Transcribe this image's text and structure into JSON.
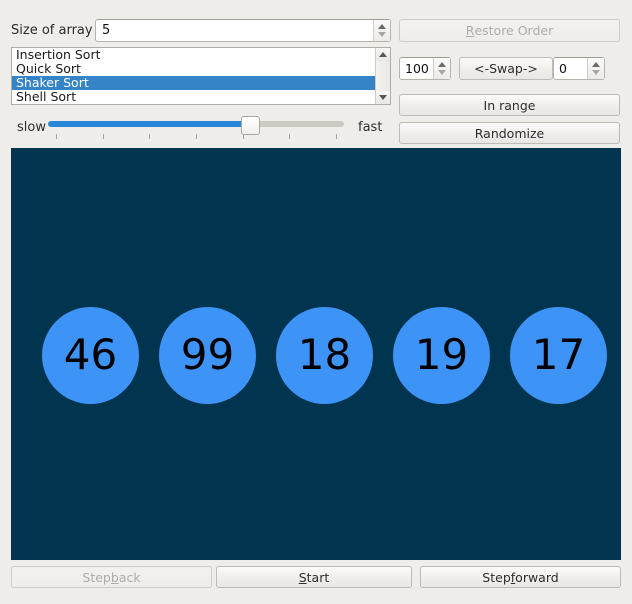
{
  "window": {
    "background": "#EFEDEA"
  },
  "controls": {
    "size_label": "Size of array",
    "size_value": "5",
    "restore_order_label": "Restore Order",
    "restore_order_mnemonic": "R",
    "restore_order_rest": "estore Order",
    "restore_order_enabled": false,
    "swap_left_value": "100",
    "swap_button_label": "<-Swap->",
    "swap_right_value": "0",
    "in_range_label": "In range",
    "randomize_label": "Randomize"
  },
  "algorithm_list": {
    "items": [
      {
        "label": "Insertion Sort",
        "selected": false
      },
      {
        "label": "Quick Sort",
        "selected": false
      },
      {
        "label": "Shaker Sort",
        "selected": true
      },
      {
        "label": "Shell Sort",
        "selected": false
      }
    ],
    "selected_label": "Shaker Sort",
    "selection_color": "#3584C8",
    "scroll_up_icon": "triangle-up-icon",
    "scroll_down_icon": "triangle-down-icon"
  },
  "speed_slider": {
    "min_label": "slow",
    "max_label": "fast",
    "value_percent": 68,
    "fill_color": "#2A86D8",
    "tick_count": 7
  },
  "canvas": {
    "background": "#00344F",
    "node_fill": "#3D94F6",
    "node_text_color": "#000000",
    "nodes": [
      {
        "value": "46"
      },
      {
        "value": "99"
      },
      {
        "value": "18"
      },
      {
        "value": "19"
      },
      {
        "value": "17"
      }
    ]
  },
  "footer": {
    "step_back_label": "Step back",
    "step_back_pre": "Step ",
    "step_back_mnemonic": "b",
    "step_back_post": "ack",
    "step_back_enabled": false,
    "start_label": "Start",
    "start_mnemonic": "S",
    "start_rest": "tart",
    "step_forward_label": "Step forward",
    "step_forward_pre": "Step ",
    "step_forward_mnemonic": "f",
    "step_forward_post": "orward"
  }
}
